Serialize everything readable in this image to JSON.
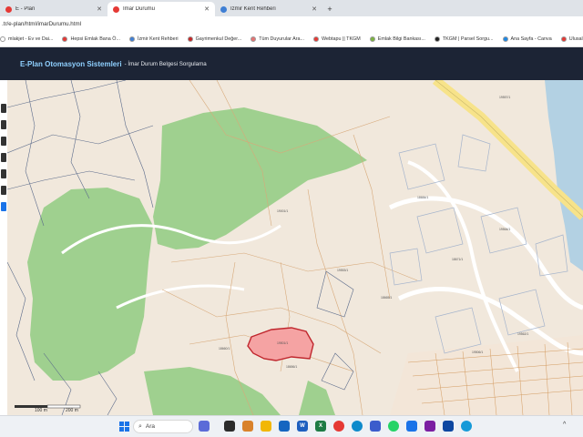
{
  "tabs": [
    {
      "label": "E - Plan",
      "icon_color": "#e53935",
      "active": false
    },
    {
      "label": "İmar Durumu",
      "icon_color": "#e53935",
      "active": true
    },
    {
      "label": "İzmir Kent Rehberi",
      "icon_color": "#3f7fd4",
      "active": false
    }
  ],
  "address": {
    "url": ".tr/e-plan/html/imarDurumu.html"
  },
  "bookmarks": [
    {
      "label": "mlakjet - Ev ve Dai...",
      "icon_color": "#ffffff"
    },
    {
      "label": "Hepsi Emlak Bana Ö...",
      "icon_color": "#e53935"
    },
    {
      "label": "İzmir Kent Rehberi",
      "icon_color": "#3f7fd4"
    },
    {
      "label": "Gayrimenkul Değer...",
      "icon_color": "#c62828"
    },
    {
      "label": "Tüm Duyurular Ara...",
      "icon_color": "#e57373"
    },
    {
      "label": "Webtapu || TKGM",
      "icon_color": "#e53935"
    },
    {
      "label": "Emlak Bilgi Bankası...",
      "icon_color": "#7cb342"
    },
    {
      "label": "TKGM | Parsel Sorgu...",
      "icon_color": "#222222"
    },
    {
      "label": "Ana Sayfa - Canva",
      "icon_color": "#1e88e5"
    },
    {
      "label": "Ulusal Coğrafi Bilgi...",
      "icon_color": "#e53935"
    }
  ],
  "header": {
    "title": "E-Plan Otomasyon Sistemleri",
    "subtitle": "- İmar Durum Belgesi Sorgulama"
  },
  "map": {
    "parcel_labels": [
      {
        "text": "19501/1"
      },
      {
        "text": "18656/1"
      },
      {
        "text": "19553/1"
      },
      {
        "text": "18665/1"
      },
      {
        "text": "19562/1"
      },
      {
        "text": "19506/1"
      },
      {
        "text": "18671/1"
      },
      {
        "text": "18684/1"
      },
      {
        "text": "19001/1"
      },
      {
        "text": "18660/1"
      },
      {
        "text": "19557/1"
      },
      {
        "text": "19564/1"
      }
    ],
    "scale": {
      "left": "100 m",
      "right": "200 m"
    },
    "selected_color": "#f5a3a3",
    "forest_color": "#9fd08f",
    "sea_color": "#b3d1e3"
  },
  "taskbar": {
    "search_placeholder": "Ara"
  }
}
